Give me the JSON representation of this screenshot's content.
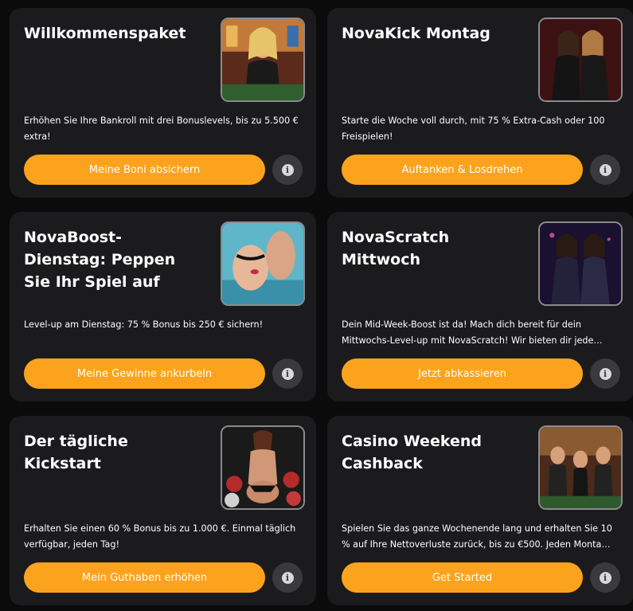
{
  "colors": {
    "background": "#0b0b0c",
    "card": "#1b1b1d",
    "accent": "#fca31d",
    "info_button": "#3a3a3d"
  },
  "info_icon_glyph": "i",
  "promotions": [
    {
      "title": "Willkommenspaket",
      "description": "Erhöhen Sie Ihre Bankroll mit drei Bonuslevels, bis zu 5.500 € extra!",
      "cta": "Meine Boni absichern",
      "image": "casino-woman-photo"
    },
    {
      "title": "NovaKick Montag",
      "description": "Starte die Woche voll durch, mit 75 % Extra-Cash oder 100 Freispielen!",
      "cta": "Auftanken & Losdrehen",
      "image": "two-women-photo"
    },
    {
      "title": "NovaBoost-\nDienstag: Peppen\nSie Ihr Spiel auf",
      "description": "Level-up am Dienstag: 75 % Bonus bis 250 € sichern!",
      "cta": "Meine Gewinne ankurbeln",
      "image": "pool-photo"
    },
    {
      "title": "NovaScratch\nMittwoch",
      "description": "Dein Mid-Week-Boost ist da! Mach dich bereit für dein Mittwochs-Level-up mit NovaScratch! Wir bieten dir jede…",
      "cta": "Jetzt abkassieren",
      "image": "two-women-leather-photo"
    },
    {
      "title": "Der tägliche\nKickstart",
      "description": "Erhalten Sie einen 60 % Bonus bis zu 1.000 €. Einmal täglich verfügbar, jeden Tag!",
      "cta": "Mein Guthaben erhöhen",
      "image": "casino-chips-photo"
    },
    {
      "title": "Casino Weekend\nCashback",
      "description": "Spielen Sie das ganze Wochenende lang und erhalten Sie 10 % auf Ihre Nettoverluste zurück, bis zu €500. Jeden Monta…",
      "cta": "Get Started",
      "image": "party-group-photo"
    }
  ]
}
